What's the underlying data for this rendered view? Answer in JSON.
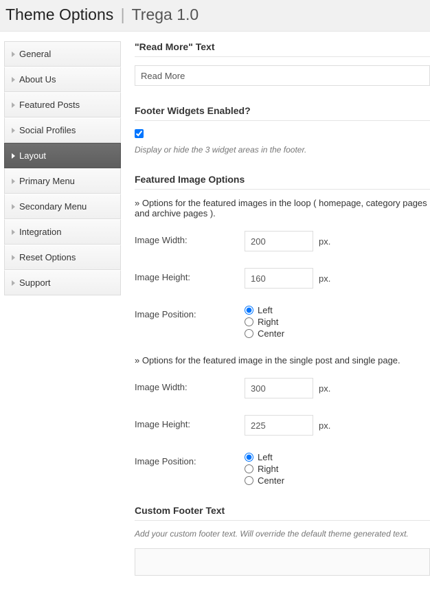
{
  "header": {
    "title": "Theme Options",
    "theme_name": "Trega 1.0"
  },
  "sidebar": {
    "items": [
      {
        "label": "General",
        "active": false
      },
      {
        "label": "About Us",
        "active": false
      },
      {
        "label": "Featured Posts",
        "active": false
      },
      {
        "label": "Social Profiles",
        "active": false
      },
      {
        "label": "Layout",
        "active": true
      },
      {
        "label": "Primary Menu",
        "active": false
      },
      {
        "label": "Secondary Menu",
        "active": false
      },
      {
        "label": "Integration",
        "active": false
      },
      {
        "label": "Reset Options",
        "active": false
      },
      {
        "label": "Support",
        "active": false
      }
    ]
  },
  "read_more": {
    "heading": "\"Read More\" Text",
    "value": "Read More"
  },
  "footer_widgets": {
    "heading": "Footer Widgets Enabled?",
    "checked": true,
    "desc": "Display or hide the 3 widget areas in the footer."
  },
  "featured": {
    "heading": "Featured Image Options",
    "loop_note": "» Options for the featured images in the loop ( homepage, category pages and archive pages ).",
    "single_note": "» Options for the featured image in the single post and single page.",
    "labels": {
      "width": "Image Width:",
      "height": "Image Height:",
      "position": "Image Position:",
      "unit": "px."
    },
    "loop": {
      "width": "200",
      "height": "160",
      "position": "Left"
    },
    "single": {
      "width": "300",
      "height": "225",
      "position": "Left"
    },
    "position_options": [
      "Left",
      "Right",
      "Center"
    ]
  },
  "custom_footer": {
    "heading": "Custom Footer Text",
    "desc": "Add your custom footer text. Will override the default theme generated text.",
    "value": ""
  }
}
